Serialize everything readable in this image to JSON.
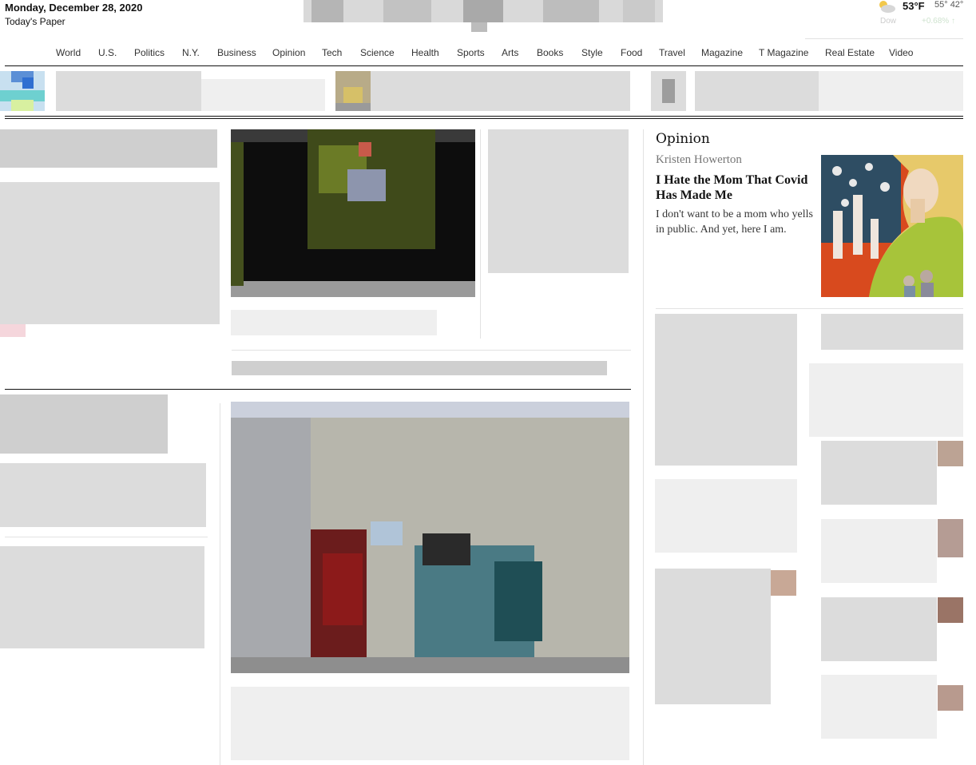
{
  "masthead": {
    "date": "Monday, December 28, 2020",
    "todays_paper": "Today's Paper",
    "weather_icon": "partly-cloudy-icon",
    "temperature": "53°F",
    "high_low": "55° 42°",
    "market_label": "Dow",
    "market_change": "+0.68% ↑"
  },
  "nav": {
    "items": [
      "World",
      "U.S.",
      "Politics",
      "N.Y.",
      "Business",
      "Opinion",
      "Tech",
      "Science",
      "Health",
      "Sports",
      "Arts",
      "Books",
      "Style",
      "Food",
      "Travel",
      "Magazine",
      "T Magazine",
      "Real Estate",
      "Video"
    ]
  },
  "opinion": {
    "section_title": "Opinion",
    "author": "Kristen Howerton",
    "headline": "I Hate the Mom That Covid Has Made Me",
    "summary": "I don't want to be a mom who yells in public. And yet, here I am."
  }
}
